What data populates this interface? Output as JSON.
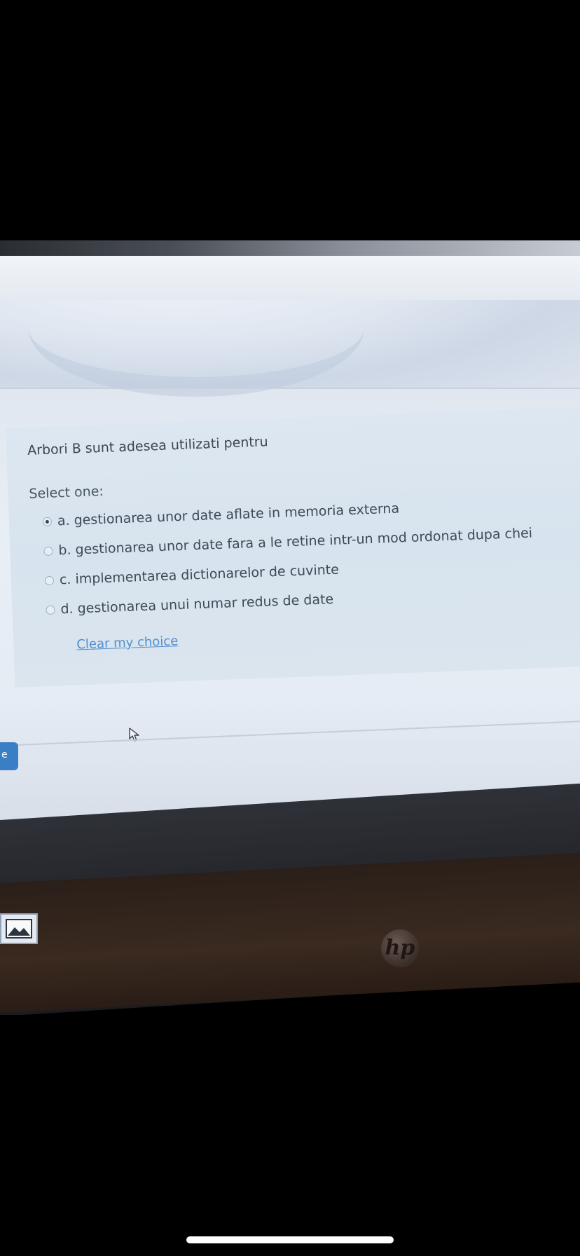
{
  "quiz": {
    "question": "Arbori B sunt adesea utilizati pentru",
    "select_label": "Select one:",
    "options": [
      {
        "label": "a. gestionarea unor date aflate in memoria externa",
        "checked": true
      },
      {
        "label": "b. gestionarea unor date fara a le retine intr-un mod ordonat dupa chei",
        "checked": false
      },
      {
        "label": "c. implementarea dictionarelor de cuvinte",
        "checked": false
      },
      {
        "label": "d. gestionarea unui numar redus de date",
        "checked": false
      }
    ],
    "clear_link": "Clear my choice"
  },
  "laptop": {
    "brand_logo": "hp"
  },
  "icons": {
    "cursor": "mouse-cursor-icon",
    "taskbar": "image-viewer-icon"
  },
  "colors": {
    "link": "#4f8fcf",
    "panel": "#dde7f1",
    "side_button": "#3a7fc6"
  }
}
